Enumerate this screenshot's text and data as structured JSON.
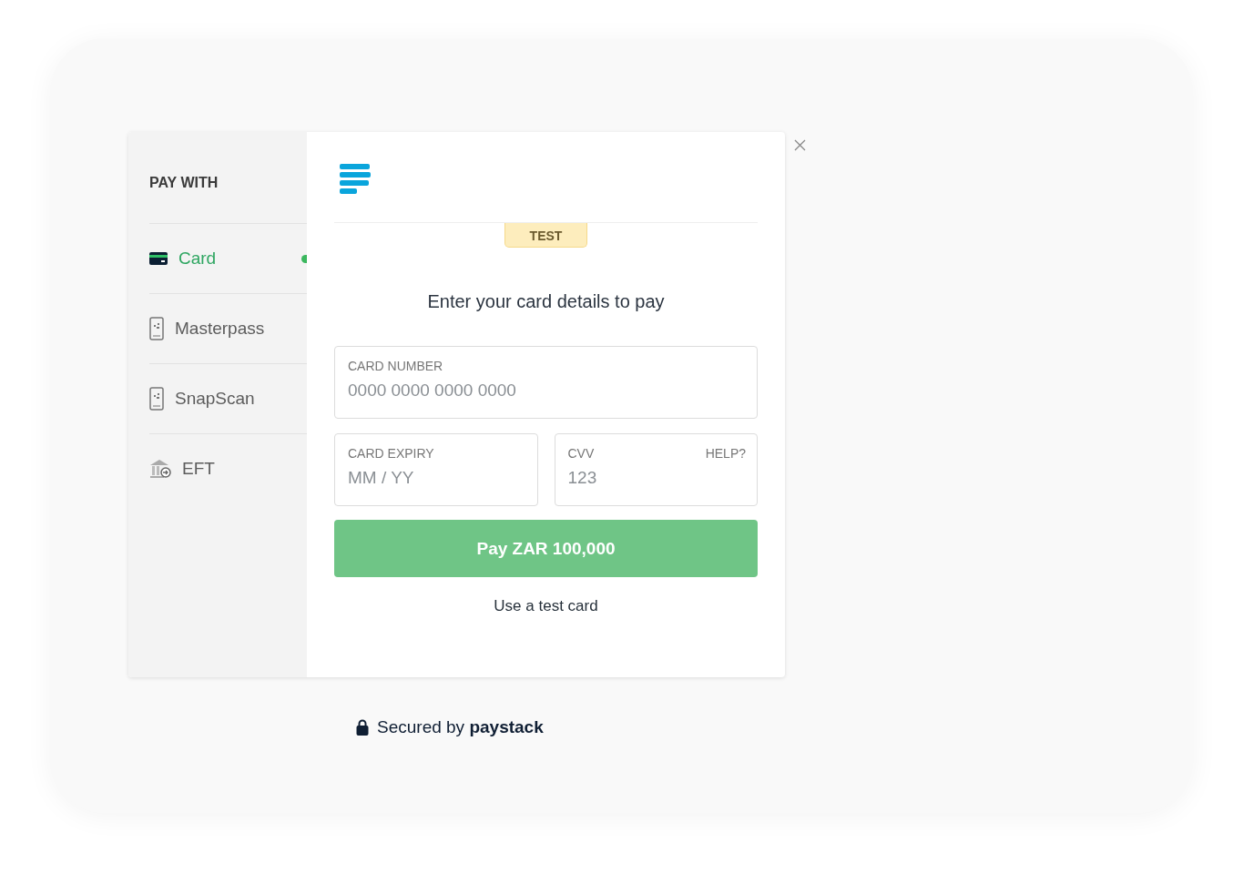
{
  "sidebar": {
    "title": "PAY WITH",
    "items": [
      {
        "label": "Card",
        "kind": "card",
        "selected": true
      },
      {
        "label": "Masterpass",
        "kind": "phone",
        "selected": false
      },
      {
        "label": "SnapScan",
        "kind": "phone",
        "selected": false
      },
      {
        "label": "EFT",
        "kind": "bank",
        "selected": false
      }
    ]
  },
  "badge": "TEST",
  "heading": "Enter your card details to pay",
  "fields": [
    {
      "label": "CARD NUMBER",
      "placeholder": "0000 0000 0000 0000"
    },
    {
      "label": "CARD EXPIRY",
      "placeholder": "MM / YY"
    },
    {
      "label": "CVV",
      "placeholder": "123",
      "help": "HELP?"
    }
  ],
  "pay_button": "Pay ZAR 100,000",
  "test_card_link": "Use a test card",
  "footer": "Secured by **paystack**"
}
